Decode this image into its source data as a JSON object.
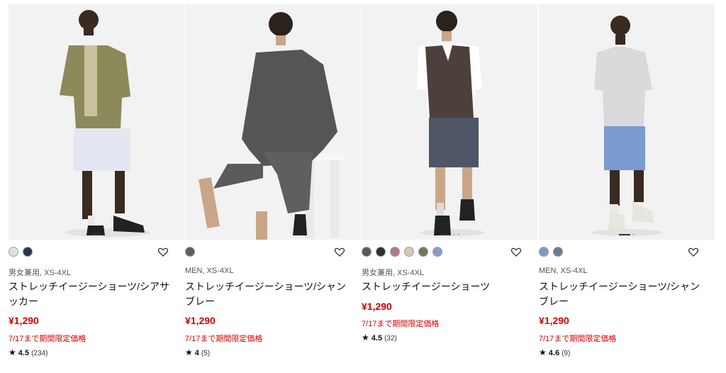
{
  "colors": {
    "price": "#d50000",
    "background": "#f1f1f1"
  },
  "products": [
    {
      "gender_size": "男女兼用, XS-4XL",
      "name": "ストレッチイージーショーツ/シアサッカー",
      "price": "¥1,290",
      "promo": "7/17まで期間限定価格",
      "rating": "4.5",
      "reviews": "(234)",
      "swatches": [
        "#dde1ea",
        "#2a3550"
      ]
    },
    {
      "gender_size": "MEN, XS-4XL",
      "name": "ストレッチイージーショーツ/シャンブレー",
      "price": "¥1,290",
      "promo": "7/17まで期間限定価格",
      "rating": "4",
      "reviews": "(5)",
      "swatches": [
        "#5f5f5f"
      ]
    },
    {
      "gender_size": "男女兼用, XS-4XL",
      "name": "ストレッチイージーショーツ",
      "price": "¥1,290",
      "promo": "7/17まで期間限定価格",
      "rating": "4.5",
      "reviews": "(32)",
      "swatches": [
        "#5a5a5a",
        "#2d3038",
        "#b07a8a",
        "#d8c6b6",
        "#6f7a5a",
        "#8a9ccc"
      ]
    },
    {
      "gender_size": "MEN, XS-4XL",
      "name": "ストレッチイージーショーツ/シャンブレー",
      "price": "¥1,290",
      "promo": "7/17まで期間限定価格",
      "rating": "4.6",
      "reviews": "(9)",
      "swatches": [
        "#7f97c7",
        "#6d7a94"
      ]
    }
  ]
}
